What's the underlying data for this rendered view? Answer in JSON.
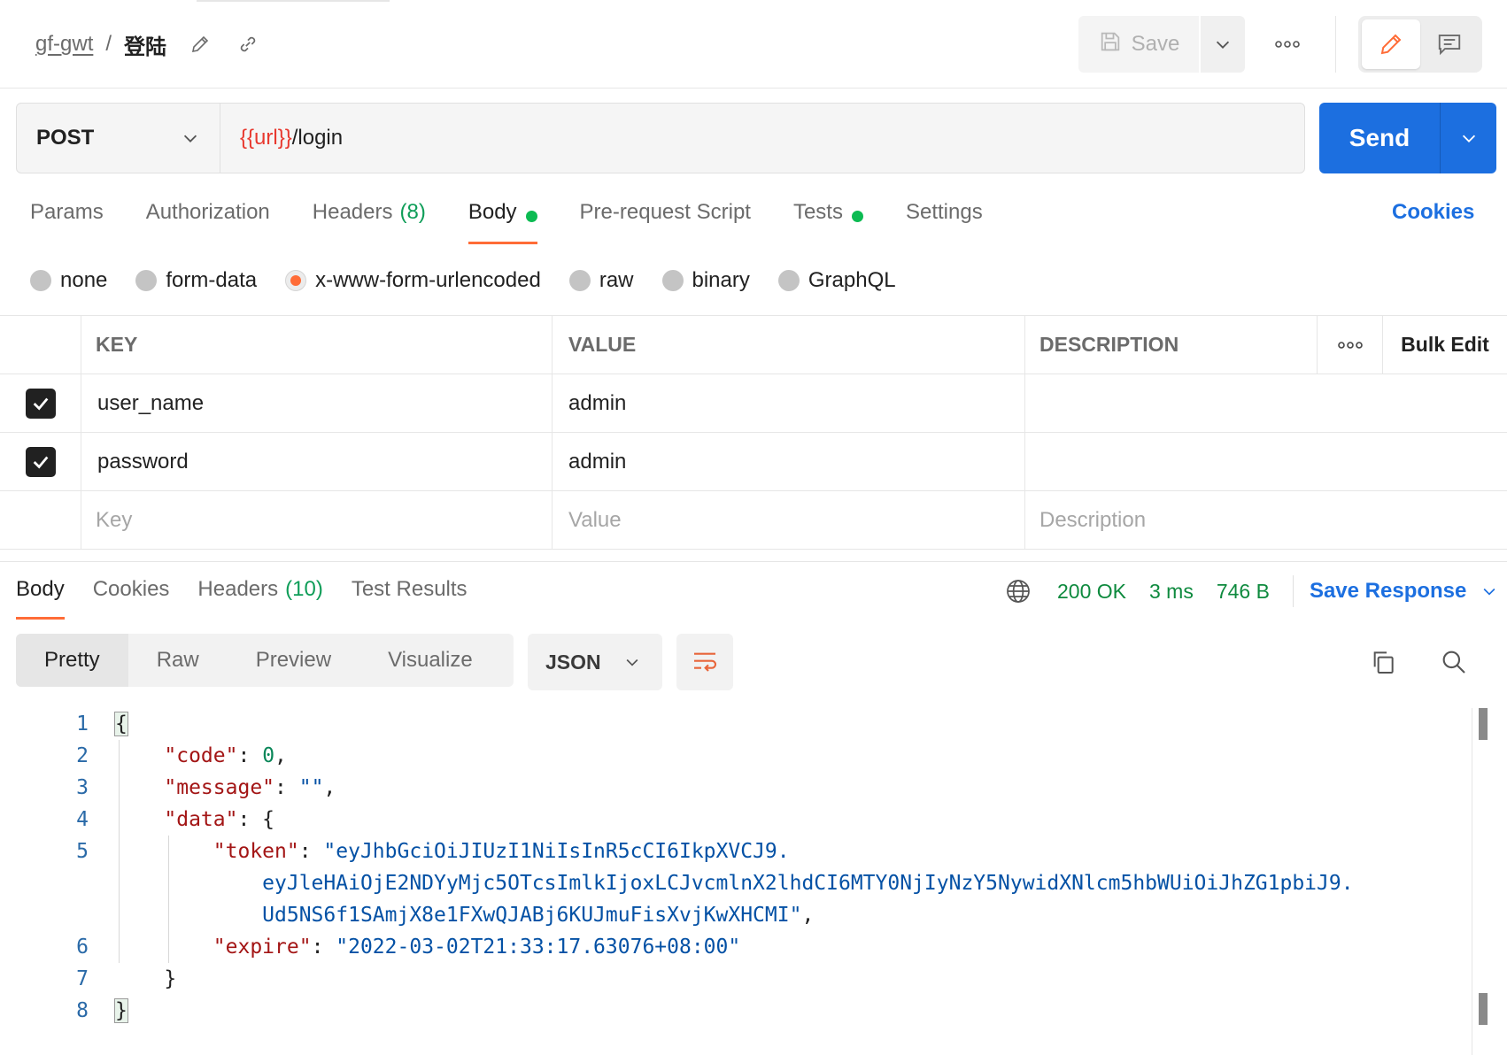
{
  "header": {
    "collection": "gf-gwt",
    "separator": "/",
    "request_name": "登陆",
    "save_label": "Save",
    "icons": [
      "pencil-icon",
      "link-icon",
      "save-disk-icon",
      "chevron-down-icon",
      "more-horizontal-icon",
      "edit-pencil-icon",
      "comment-icon"
    ]
  },
  "request": {
    "method": "POST",
    "url_variable": "{{url}}",
    "url_path": "/login",
    "send_label": "Send"
  },
  "request_tabs": [
    {
      "label": "Params"
    },
    {
      "label": "Authorization"
    },
    {
      "label": "Headers",
      "count": "(8)"
    },
    {
      "label": "Body",
      "active": true,
      "dot": true
    },
    {
      "label": "Pre-request Script"
    },
    {
      "label": "Tests",
      "dot": true
    },
    {
      "label": "Settings"
    }
  ],
  "cookies_label": "Cookies",
  "body_types": [
    "none",
    "form-data",
    "x-www-form-urlencoded",
    "raw",
    "binary",
    "GraphQL"
  ],
  "body_type_selected": "x-www-form-urlencoded",
  "table": {
    "headers": {
      "key": "KEY",
      "value": "VALUE",
      "description": "DESCRIPTION",
      "bulk_edit": "Bulk Edit"
    },
    "rows": [
      {
        "checked": true,
        "key": "user_name",
        "value": "admin",
        "description": ""
      },
      {
        "checked": true,
        "key": "password",
        "value": "admin",
        "description": ""
      }
    ],
    "placeholders": {
      "key": "Key",
      "value": "Value",
      "description": "Description"
    }
  },
  "response": {
    "tabs": [
      {
        "label": "Body",
        "active": true
      },
      {
        "label": "Cookies"
      },
      {
        "label": "Headers",
        "count": "(10)"
      },
      {
        "label": "Test Results"
      }
    ],
    "status": "200 OK",
    "time": "3 ms",
    "size": "746 B",
    "save_response_label": "Save Response",
    "view_modes": [
      "Pretty",
      "Raw",
      "Preview",
      "Visualize"
    ],
    "view_selected": "Pretty",
    "format": "JSON"
  },
  "code": {
    "line_numbers": [
      "1",
      "2",
      "3",
      "4",
      "5",
      "",
      "",
      "6",
      "7",
      "8"
    ],
    "lines": {
      "l1": "{",
      "code_key": "\"code\"",
      "code_val": "0",
      "message_key": "\"message\"",
      "message_val": "\"\"",
      "data_key": "\"data\"",
      "token_key": "\"token\"",
      "token_1": "\"eyJhbGciOiJIUzI1NiIsInR5cCI6IkpXVCJ9.",
      "token_2": "eyJleHAiOjE2NDYyMjc5OTcsImlkIjoxLCJvcmlnX2lhdCI6MTY0NjIyNzY5NywidXNlcm5hbWUiOiJhZG1pbiJ9.",
      "token_3": "Ud5NS6f1SAmjX8e1FXwQJABj6KUJmuFisXvjKwXHCMI\"",
      "expire_key": "\"expire\"",
      "expire_val": "\"2022-03-02T21:33:17.63076+08:00\"",
      "close_inner": "}",
      "close_outer": "}"
    }
  }
}
